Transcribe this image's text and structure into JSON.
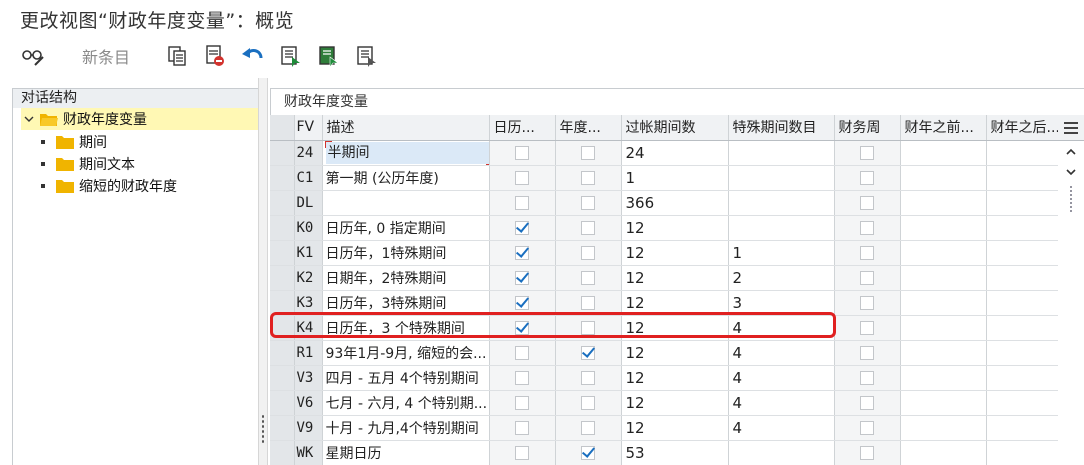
{
  "window": {
    "title": "更改视图“财政年度变量”：概览"
  },
  "toolbar": {
    "new_entries_label": "新条目"
  },
  "tree": {
    "caption": "对话结构",
    "root": "财政年度变量",
    "children": [
      "期间",
      "期间文本",
      "缩短的财政年度"
    ]
  },
  "table": {
    "group_title": "财政年度变量",
    "columns": [
      "FV",
      "描述",
      "日历...",
      "年度...",
      "过帐期间数",
      "特殊期间数目",
      "财务周",
      "财年之前...",
      "财年之后..."
    ],
    "rows": [
      {
        "fv": "24",
        "desc": "半期间",
        "calendar": false,
        "year_dep": false,
        "periods": "24",
        "special": "",
        "week": false
      },
      {
        "fv": "C1",
        "desc": "第一期 (公历年度)",
        "calendar": false,
        "year_dep": false,
        "periods": "1",
        "special": "",
        "week": false
      },
      {
        "fv": "DL",
        "desc": "",
        "calendar": false,
        "year_dep": false,
        "periods": "366",
        "special": "",
        "week": false
      },
      {
        "fv": "K0",
        "desc": "日历年, 0 指定期间",
        "calendar": true,
        "year_dep": false,
        "periods": "12",
        "special": "",
        "week": false
      },
      {
        "fv": "K1",
        "desc": "日历年，1特殊期间",
        "calendar": true,
        "year_dep": false,
        "periods": "12",
        "special": "1",
        "week": false
      },
      {
        "fv": "K2",
        "desc": "日期年，2特殊期间",
        "calendar": true,
        "year_dep": false,
        "periods": "12",
        "special": "2",
        "week": false
      },
      {
        "fv": "K3",
        "desc": "日历年，3特殊期间",
        "calendar": true,
        "year_dep": false,
        "periods": "12",
        "special": "3",
        "week": false
      },
      {
        "fv": "K4",
        "desc": "日历年，3 个特殊期间",
        "calendar": true,
        "year_dep": false,
        "periods": "12",
        "special": "4",
        "week": false
      },
      {
        "fv": "R1",
        "desc": "93年1月-9月, 缩短的会...",
        "calendar": false,
        "year_dep": true,
        "periods": "12",
        "special": "4",
        "week": false
      },
      {
        "fv": "V3",
        "desc": "四月 - 五月 4个特别期间",
        "calendar": false,
        "year_dep": false,
        "periods": "12",
        "special": "4",
        "week": false
      },
      {
        "fv": "V6",
        "desc": "七月 - 六月, 4 个特别期...",
        "calendar": false,
        "year_dep": false,
        "periods": "12",
        "special": "4",
        "week": false
      },
      {
        "fv": "V9",
        "desc": "十月 - 九月,4个特别期间",
        "calendar": false,
        "year_dep": false,
        "periods": "12",
        "special": "4",
        "week": false
      },
      {
        "fv": "WK",
        "desc": "星期日历",
        "calendar": false,
        "year_dep": true,
        "periods": "53",
        "special": "",
        "week": false
      }
    ]
  },
  "colors": {
    "accent": "#1a6fc0",
    "highlight": "#e02020",
    "tree_selected": "#fff8b4"
  }
}
